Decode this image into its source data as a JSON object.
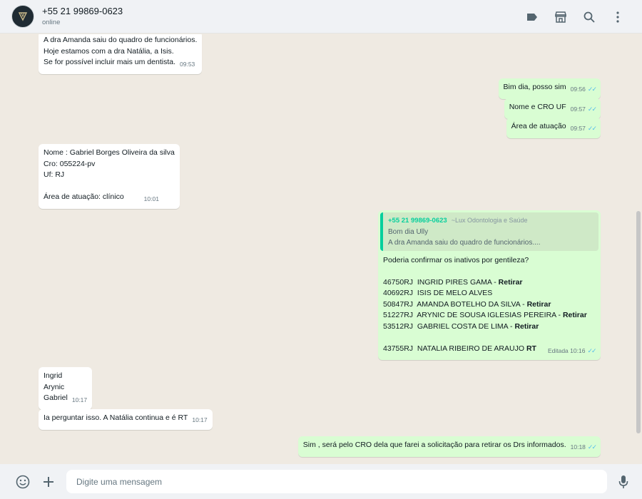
{
  "header": {
    "contact_name": "+55 21 99869-0623",
    "status": "online",
    "icons": [
      "label-icon",
      "store-icon",
      "search-icon",
      "menu-icon"
    ]
  },
  "messages": [
    {
      "dir": "in",
      "lines": [
        "A dra Amanda saiu do quadro de funcionários.",
        "Hoje estamos com a dra Natália, a Isis.",
        "Se for possível incluir mais um dentista."
      ],
      "time": "09:53"
    },
    {
      "dir": "out",
      "lines": [
        "Bim dia, posso sim"
      ],
      "time": "09:56"
    },
    {
      "dir": "out",
      "lines": [
        "Nome e CRO UF"
      ],
      "time": "09:57"
    },
    {
      "dir": "out",
      "lines": [
        "Área de atuação"
      ],
      "time": "09:57"
    },
    {
      "dir": "in",
      "lines": [
        "Nome : Gabriel Borges Oliveira da silva",
        "Cro: 055224-pv",
        "Uf: RJ",
        "",
        "Área de atuação: clínico"
      ],
      "time": "10:01"
    },
    {
      "dir": "out",
      "quote": {
        "author": "+55 21 99869-0623",
        "group": "~Lux Odontologia e Saúde",
        "lines": [
          "Bom dia Ully",
          "A dra Amanda saiu do quadro de funcionários...."
        ]
      },
      "intro": "Poderia confirmar os inativos por gentileza?",
      "list": [
        {
          "cro": "46750RJ",
          "name": "INGRID PIRES GAMA",
          "sep": " - ",
          "tag": "Retirar"
        },
        {
          "cro": "40692RJ",
          "name": "ISIS DE MELO ALVES",
          "sep": "",
          "tag": ""
        },
        {
          "cro": "50847RJ",
          "name": "AMANDA BOTELHO DA SILVA",
          "sep": " - ",
          "tag": "Retirar"
        },
        {
          "cro": "51227RJ",
          "name": "ARYNIC DE SOUSA IGLESIAS PEREIRA",
          "sep": " - ",
          "tag": "Retirar"
        },
        {
          "cro": "53512RJ",
          "name": "GABRIEL COSTA DE LIMA",
          "sep": " - ",
          "tag": "Retirar"
        }
      ],
      "last": {
        "cro": "43755RJ",
        "name": "NATALIA RIBEIRO DE ARAUJO",
        "sep": " ",
        "tag": "RT"
      },
      "edited": "Editada",
      "time": "10:16"
    },
    {
      "dir": "in",
      "lines": [
        "Ingrid",
        "Arynic",
        "Gabriel"
      ],
      "time": "10:17"
    },
    {
      "dir": "in",
      "lines": [
        "Ia perguntar isso. A Natália continua e é RT"
      ],
      "time": "10:17"
    },
    {
      "dir": "out",
      "lines": [
        "Sim , será pelo CRO dela que farei a solicitação para retirar os Drs informados."
      ],
      "time": "10:18"
    }
  ],
  "footer": {
    "placeholder": "Digite uma mensagem",
    "icons": [
      "emoji-icon",
      "plus-icon",
      "mic-icon"
    ]
  },
  "colors": {
    "incoming": "#ffffff",
    "outgoing": "#d9fdd3",
    "ticks": "#53bdeb",
    "quote_accent": "#06cf9c",
    "chat_bg": "#efeae2"
  }
}
